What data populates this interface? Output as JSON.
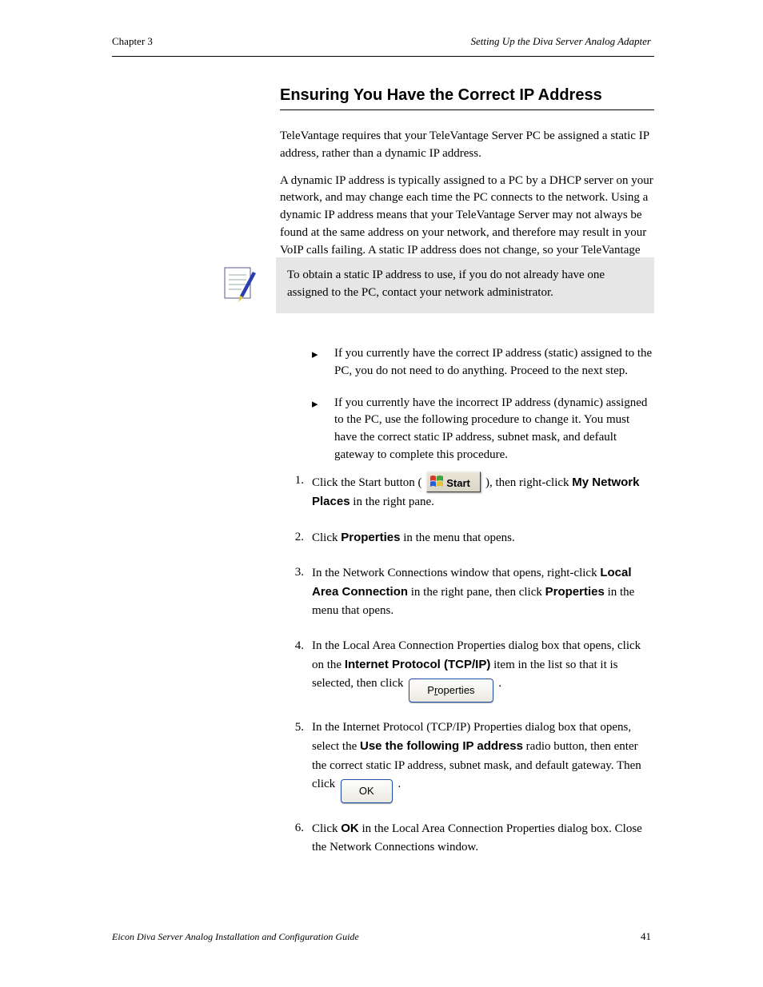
{
  "header": {
    "chapter": "Chapter 3",
    "title_right": "Setting Up the Diva Server Analog Adapter"
  },
  "section": {
    "title": "Ensuring You Have the Correct IP Address"
  },
  "intro": {
    "p1": "TeleVantage requires that your TeleVantage Server PC be assigned a static IP address, rather than a dynamic IP address.",
    "p2": "A dynamic IP address is typically assigned to a PC by a DHCP server on your network, and may change each time the PC connects to the network. Using a dynamic IP address means that your TeleVantage Server may not always be found at the same address on your network, and therefore may result in your VoIP calls failing. A static IP address does not change, so your TeleVantage Server will always be found at the same address on your network, even if the PC is rebooted."
  },
  "note": {
    "text": "To obtain a static IP address to use, if you do not already have one assigned to the PC, contact your network administrator."
  },
  "hand_items": [
    "If you currently have the correct IP address (static) assigned to the PC, you do not need to do anything. Proceed to the next step.",
    "If you currently have the incorrect IP address (dynamic) assigned to the PC, use the following procedure to change it. You must have the correct static IP address, subnet mask, and default gateway to complete this procedure."
  ],
  "steps": [
    {
      "num": "1.",
      "pre": "Click the Start button (",
      "post": "), then right-click ",
      "bold_after_post": "My Network Places",
      "tail": " in the right pane.",
      "start_label": "Start"
    },
    {
      "num": "2.",
      "text_pre": "Click ",
      "bold1": "Properties",
      "mid": " in the menu that opens."
    },
    {
      "num": "3.",
      "text_pre": "In the Network Connections window that opens, right-click ",
      "bold1": "Local Area Connection",
      "mid": " in the right pane, then click ",
      "bold2": "Properties",
      "tail": " in the menu that opens."
    },
    {
      "num": "4.",
      "text_pre": "In the Local Area Connection Properties dialog box that opens, click on the ",
      "bold1": "Internet Protocol (TCP/IP)",
      "mid": " item in the list so that it is selected, then click ",
      "button_label": "Properties",
      "button_ul": "r",
      "tail": "."
    },
    {
      "num": "5.",
      "text_pre": "In the Internet Protocol (TCP/IP) Properties dialog box that opens, select the ",
      "bold1": "Use the following IP address",
      "mid": " radio button, then enter the correct static IP address, subnet mask, and default gateway. Then click ",
      "button_label": "OK",
      "tail": "."
    },
    {
      "num": "6.",
      "text_pre": "Click ",
      "bold1": "OK",
      "mid": " in the Local Area Connection Properties dialog box. Close the Network Connections window."
    }
  ],
  "footer": {
    "left": "Eicon Diva Server Analog Installation and Configuration Guide",
    "right": "41"
  }
}
